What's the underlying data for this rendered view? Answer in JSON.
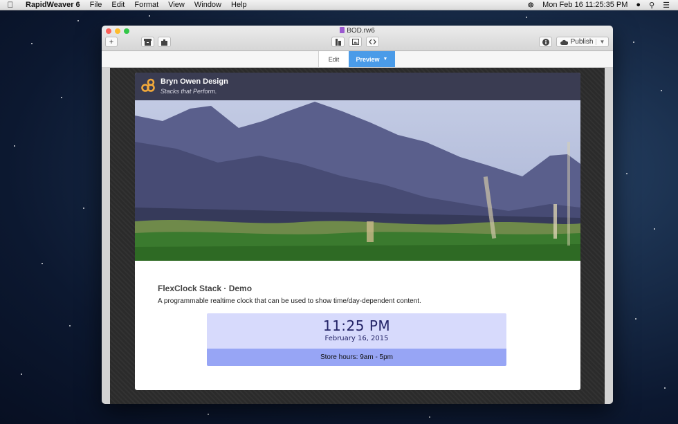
{
  "menubar": {
    "app_name": "RapidWeaver 6",
    "menus": [
      "File",
      "Edit",
      "Format",
      "View",
      "Window",
      "Help"
    ],
    "datetime": "Mon Feb 16  11:25:35 PM"
  },
  "window": {
    "title": "BOD.rw6",
    "toolbar": {
      "add_icon": "+",
      "publish_label": "Publish"
    },
    "modes": {
      "edit_label": "Edit",
      "preview_label": "Preview"
    }
  },
  "site": {
    "brand": "Bryn Owen Design",
    "tagline": "Stacks that Perform.",
    "heading": "FlexClock Stack · Demo",
    "description": "A programmable realtime clock that can be used to show time/day-dependent content.",
    "clock": {
      "time": "11:25 PM",
      "date": "February 16, 2015",
      "store_hours": "Store hours: 9am - 5pm"
    }
  },
  "colors": {
    "preview_accent": "#4a9be8",
    "site_header": "#3a3c52",
    "logo": "#f2a93b",
    "clock_top": "#d7dafc",
    "clock_bottom": "#97a5f5"
  }
}
